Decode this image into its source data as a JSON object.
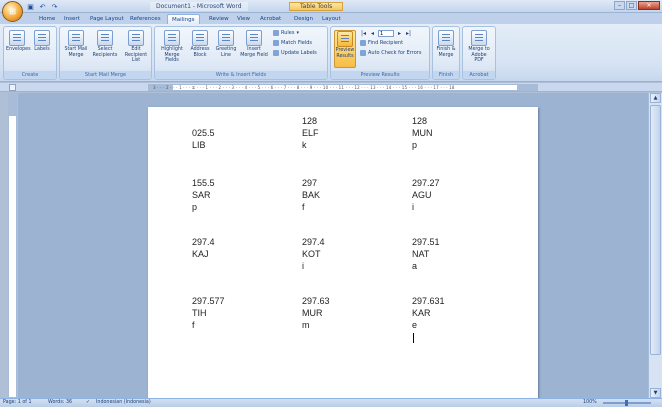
{
  "titlebar": {
    "title": "Document1 - Microsoft Word",
    "context_tab": "Table Tools",
    "office_glyph": "⊞",
    "qat": [
      "save-icon",
      "undo-icon",
      "redo-icon"
    ],
    "window_buttons": [
      "–",
      "□",
      "✕"
    ]
  },
  "tabs": [
    "Home",
    "Insert",
    "Page Layout",
    "References",
    "Mailings",
    "Review",
    "View",
    "Acrobat",
    "Design",
    "Layout"
  ],
  "active_tab": "Mailings",
  "ribbon": {
    "create": {
      "label": "Create",
      "envelopes": "Envelopes",
      "labels": "Labels"
    },
    "start_mail_merge": {
      "label": "Start Mail Merge",
      "start": "Start Mail Merge",
      "select": "Select Recipients",
      "edit": "Edit Recipient List"
    },
    "write_insert": {
      "label": "Write & Insert Fields",
      "highlight": "Highlight Merge Fields",
      "address": "Address Block",
      "greeting": "Greeting Line",
      "insert": "Insert Merge Field",
      "rules": "Rules",
      "match": "Match Fields",
      "update": "Update Labels"
    },
    "preview": {
      "label": "Preview Results",
      "button": "Preview Results",
      "record": "1",
      "find": "Find Recipient",
      "auto_check": "Auto Check for Errors"
    },
    "finish": {
      "label": "Finish",
      "button": "Finish & Merge"
    },
    "acrobat": {
      "label": "Acrobat",
      "button": "Merge to Adobe PDF"
    }
  },
  "ruler_text": "3 · · · 2 · · · 1 · · · ⧖ · · · 1 · · · 2 · · · 3 · · · 4 · · · 5 · · · 6 · · · 7 · · · 8 · · · 9 · · · 10 · · · 11 · · · 12 · · · 13 · · · 14 · · · 15 · · · 16 · · · 17 · · · 18",
  "labels": [
    [
      "025.5",
      "LIB",
      ""
    ],
    [
      "128",
      "ELF",
      "k"
    ],
    [
      "128",
      "MUN",
      "p"
    ],
    [
      "155.5",
      "SAR",
      "p"
    ],
    [
      "297",
      "BAK",
      "f"
    ],
    [
      "297.27",
      "AGU",
      "i"
    ],
    [
      "297.4",
      "KAJ",
      ""
    ],
    [
      "297.4",
      "KOT",
      "i"
    ],
    [
      "297.51",
      "NAT",
      "a"
    ],
    [
      "297.577",
      "TIH",
      "f"
    ],
    [
      "297.63",
      "MUR",
      "m"
    ],
    [
      "297.631",
      "KAR",
      "e"
    ]
  ],
  "status": {
    "page": "Page: 1 of 1",
    "words": "Words: 36",
    "language": "Indonesian (Indonesia)",
    "zoom": "100%"
  }
}
